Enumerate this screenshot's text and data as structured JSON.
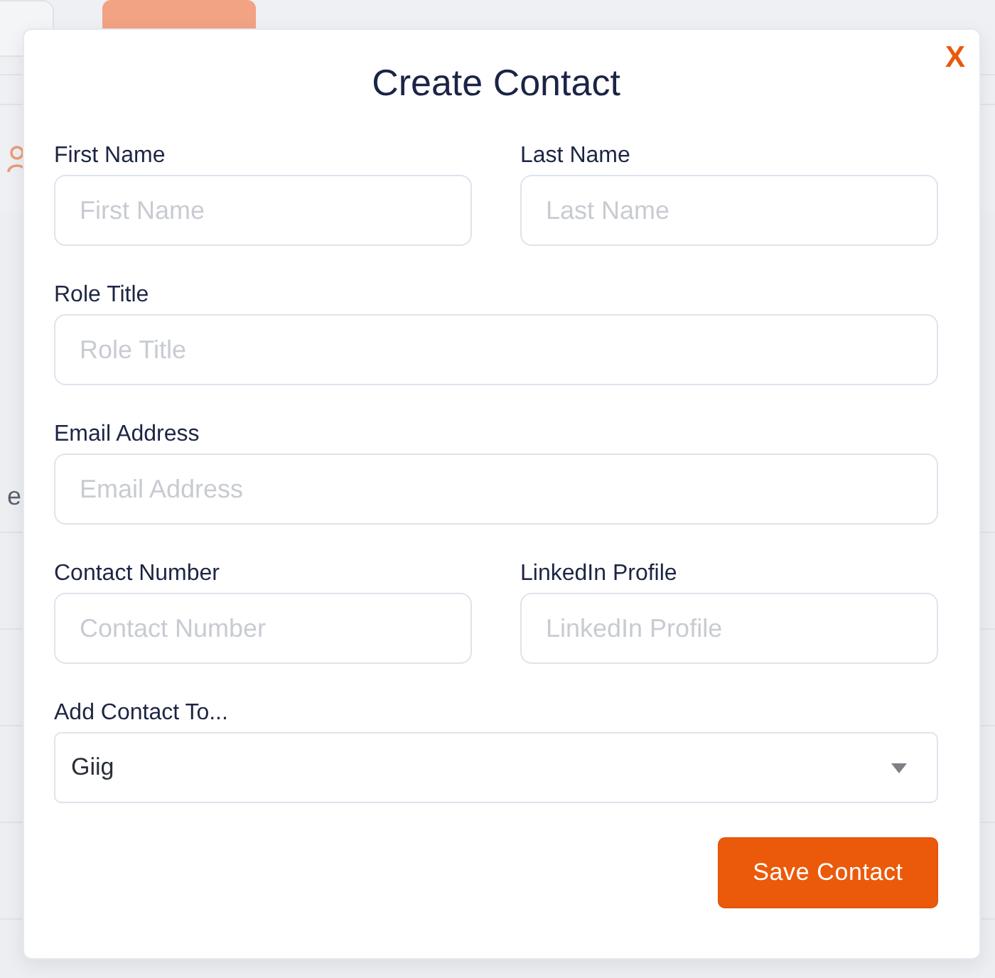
{
  "background": {
    "text_fragment": "e"
  },
  "dialog": {
    "title": "Create Contact",
    "close_label": "X",
    "rows": [
      [
        {
          "kind": "text",
          "label": "First Name",
          "placeholder": "First Name"
        },
        {
          "kind": "text",
          "label": "Last Name",
          "placeholder": "Last Name"
        }
      ],
      [
        {
          "kind": "text",
          "label": "Role Title",
          "placeholder": "Role Title"
        }
      ],
      [
        {
          "kind": "text",
          "label": "Email Address",
          "placeholder": "Email Address"
        }
      ],
      [
        {
          "kind": "text",
          "label": "Contact Number",
          "placeholder": "Contact Number"
        },
        {
          "kind": "text",
          "label": "LinkedIn Profile",
          "placeholder": "LinkedIn Profile"
        }
      ],
      [
        {
          "kind": "select",
          "label": "Add Contact To...",
          "value": "Giig"
        }
      ]
    ],
    "save_button": "Save Contact"
  }
}
